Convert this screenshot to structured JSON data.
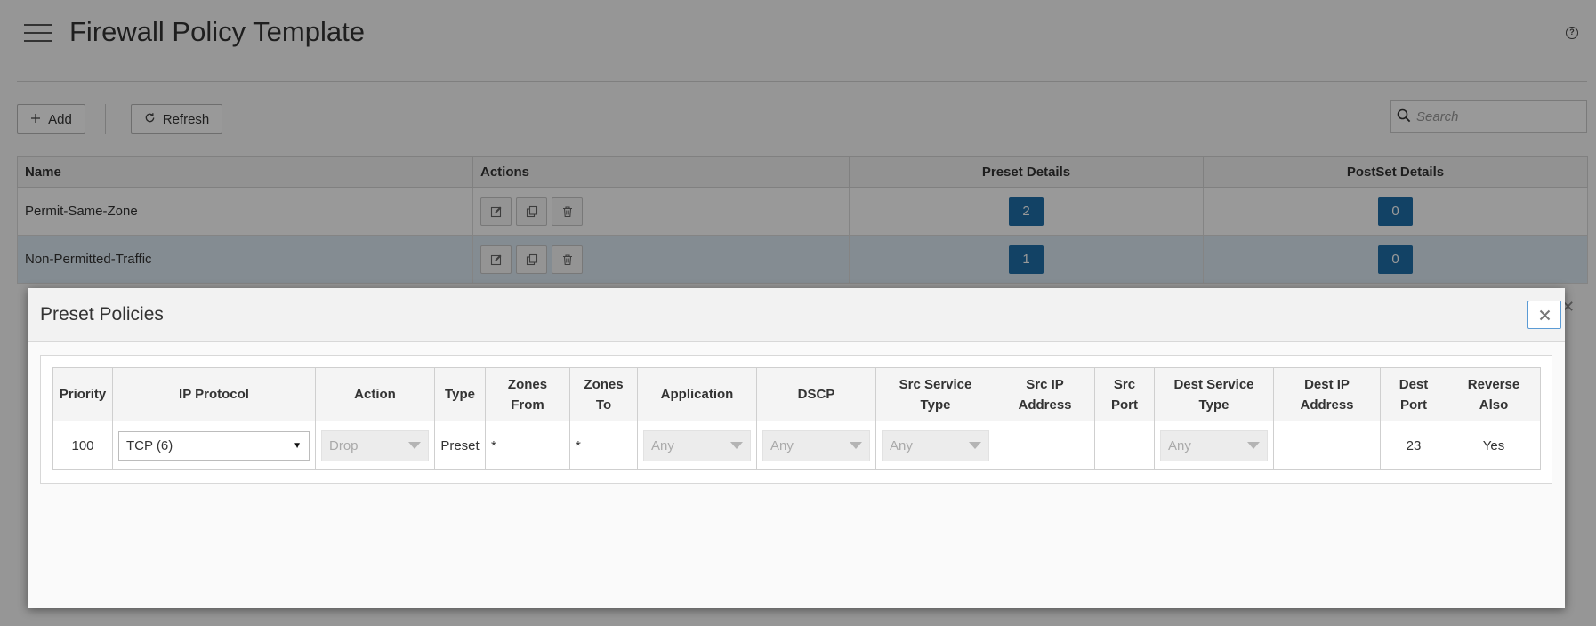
{
  "page": {
    "title": "Firewall Policy Template",
    "toolbar": {
      "add_label": "Add",
      "refresh_label": "Refresh"
    },
    "search": {
      "placeholder": "Search"
    },
    "grid": {
      "columns": [
        "Name",
        "Actions",
        "Preset Details",
        "PostSet Details"
      ],
      "rows": [
        {
          "name": "Permit-Same-Zone",
          "preset": "2",
          "postset": "0"
        },
        {
          "name": "Non-Permitted-Traffic",
          "preset": "1",
          "postset": "0"
        }
      ]
    }
  },
  "modal": {
    "title": "Preset Policies",
    "close_symbol": "✕",
    "columns": {
      "priority": "Priority",
      "ip_protocol": "IP Protocol",
      "action": "Action",
      "type": "Type",
      "zones_from": [
        "Zones",
        "From"
      ],
      "zones_to": [
        "Zones",
        "To"
      ],
      "application": "Application",
      "dscp": "DSCP",
      "src_service_type": [
        "Src Service",
        "Type"
      ],
      "src_ip_address": [
        "Src IP",
        "Address"
      ],
      "src_port": [
        "Src",
        "Port"
      ],
      "dest_service_type": [
        "Dest Service",
        "Type"
      ],
      "dest_ip_address": [
        "Dest IP",
        "Address"
      ],
      "dest_port": [
        "Dest",
        "Port"
      ],
      "reverse_also": [
        "Reverse",
        "Also"
      ]
    },
    "row": {
      "priority": "100",
      "ip_protocol": "TCP (6)",
      "action": "Drop",
      "type": "Preset",
      "zones_from": "*",
      "zones_to": "*",
      "application": "Any",
      "dscp": "Any",
      "src_service_type": "Any",
      "src_ip_address": "",
      "src_port": "",
      "dest_service_type": "Any",
      "dest_ip_address": "",
      "dest_port": "23",
      "reverse_also": "Yes"
    }
  },
  "colors": {
    "accent": "#1f6fa8",
    "selected_row": "#dde9f3",
    "close_border": "#5b9bd5"
  }
}
